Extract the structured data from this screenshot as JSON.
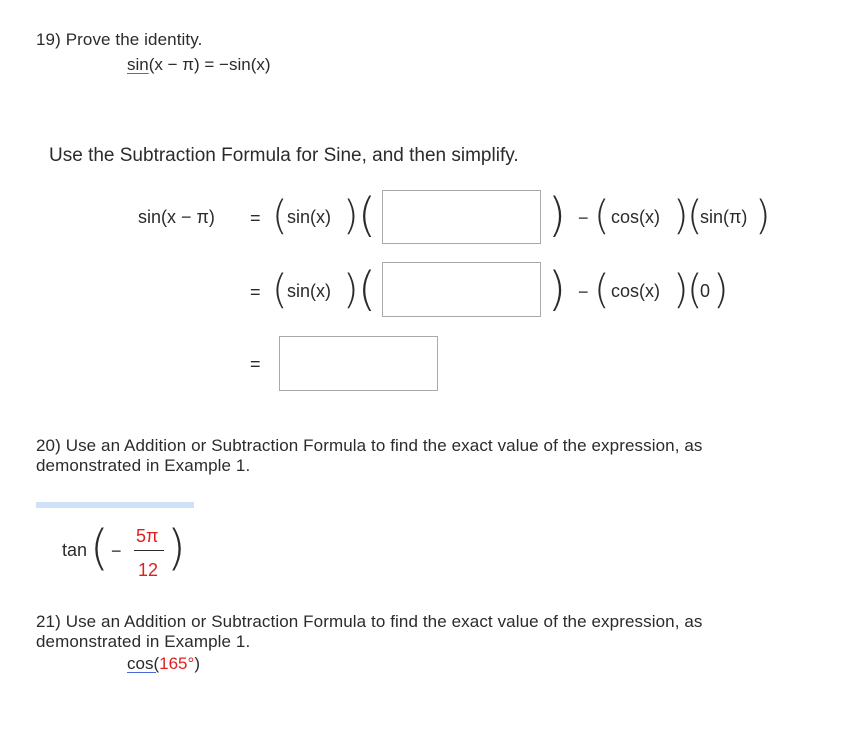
{
  "q19": {
    "title": "19) Prove the identity.",
    "identity_fn": "sin",
    "identity_rest": "(x − π) = −sin(x)",
    "instruction": "Use the Subtraction Formula for Sine, and then simplify.",
    "row1": {
      "lhs": "sin(x − π)",
      "eq": "=",
      "term1": "sin(x)",
      "minus": "−",
      "term2": "cos(x)",
      "term3": "sin(π)"
    },
    "row2": {
      "eq": "=",
      "term1": "sin(x)",
      "minus": "−",
      "term2": "cos(x)",
      "term3": "0"
    },
    "row3": {
      "eq": "="
    }
  },
  "q20": {
    "title_line1": "20) Use an Addition or Subtraction Formula to find the exact value of the expression, as",
    "title_line2": "demonstrated in Example 1.",
    "fn": "tan",
    "sign": "−",
    "numerator": "5π",
    "denominator": "12"
  },
  "q21": {
    "title_line1": "21) Use an Addition or Subtraction Formula to find the exact value of the expression, as",
    "title_line2": "demonstrated in Example 1.",
    "fn": "cos",
    "open": "(",
    "angle": "165°",
    "close": ")"
  }
}
